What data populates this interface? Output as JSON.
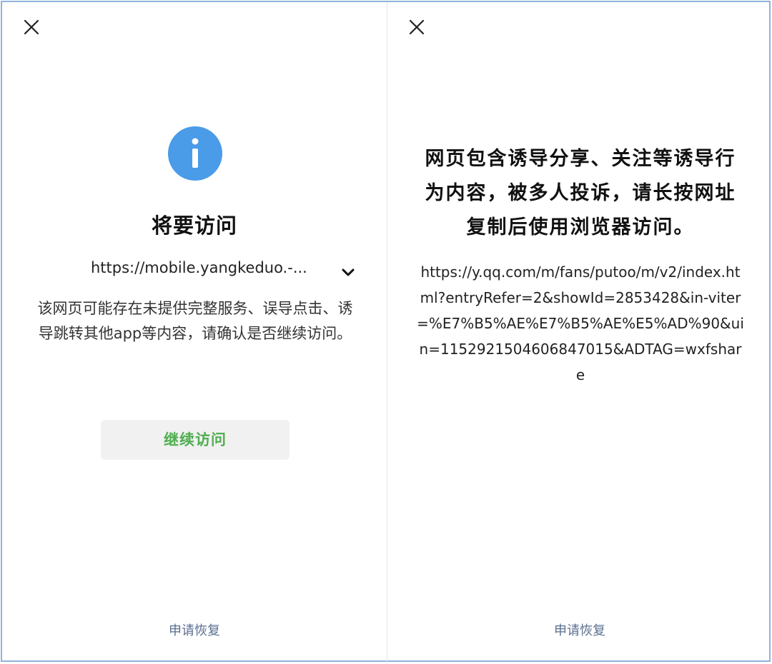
{
  "left_panel": {
    "title": "将要访问",
    "url": "https://mobile.yangkeduo.-...",
    "warning": "该网页可能存在未提供完整服务、误导点击、诱导跳转其他app等内容，请确认是否继续访问。",
    "continue_label": "继续访问",
    "appeal_label": "申请恢复",
    "icons": {
      "close": "close-icon",
      "info": "info-icon",
      "expand": "chevron-down-icon"
    },
    "colors": {
      "info_icon": "#4a9be8",
      "continue_text": "#4fae4f",
      "button_bg": "#f1f1f1",
      "appeal_link": "#5b6f91"
    }
  },
  "right_panel": {
    "headline": "网页包含诱导分享、关注等诱导行为内容，被多人投诉，请长按网址复制后使用浏览器访问。",
    "url": "https://y.qq.com/m/fans/putoo/m/v2/index.html?entryRefer=2&showId=2853428&in-viter=%E7%B5%AE%E7%B5%AE%E5%AD%90&uin=1152921504606847015&ADTAG=wxfshare",
    "appeal_label": "申请恢复",
    "icons": {
      "close": "close-icon"
    }
  }
}
